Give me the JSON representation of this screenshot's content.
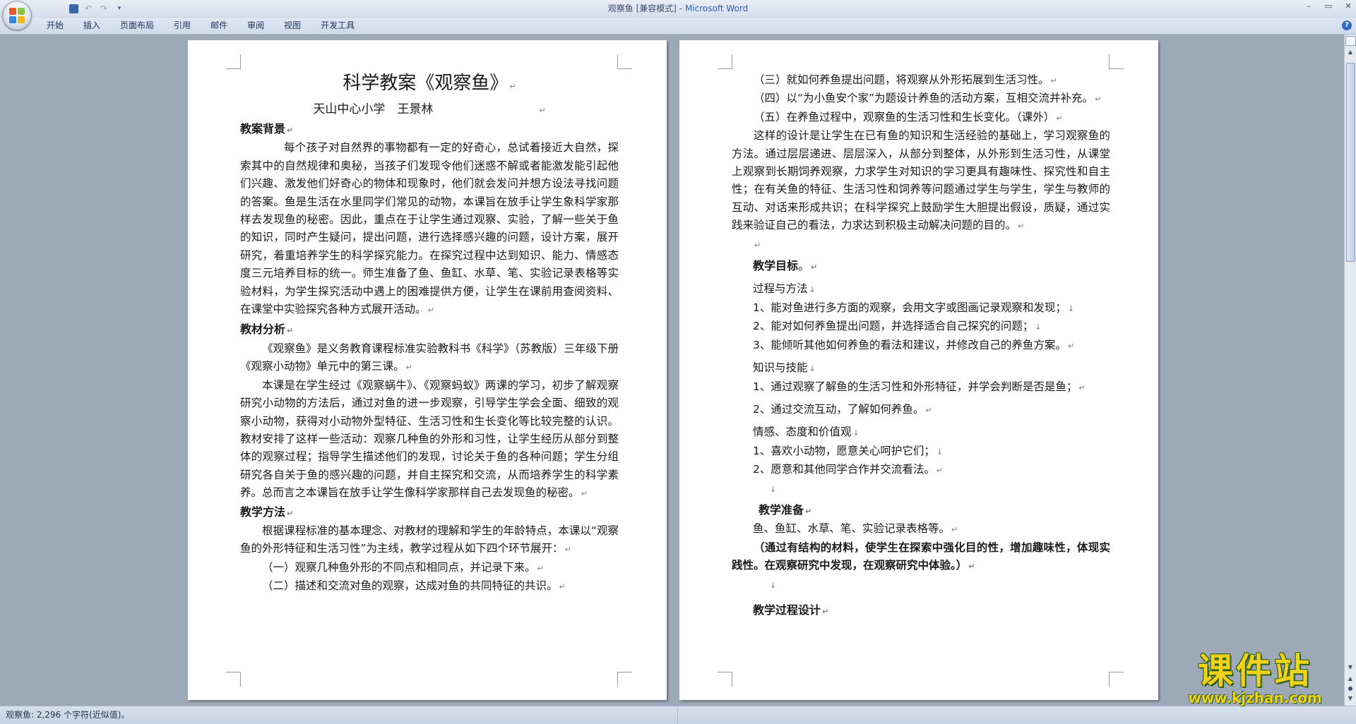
{
  "window": {
    "doc_name": "观察鱼",
    "mode": "[兼容模式]",
    "separator": "-",
    "app_name": "Microsoft Word"
  },
  "quick_access": [
    "save-icon",
    "undo-icon",
    "redo-icon",
    "customize-icon"
  ],
  "ribbon": {
    "tabs": [
      "开始",
      "插入",
      "页面布局",
      "引用",
      "邮件",
      "审阅",
      "视图",
      "开发工具"
    ]
  },
  "page_left": {
    "title": "科学教案《观察鱼》",
    "subtitle": "天山中心小学　王景林",
    "h_background": "教案背景",
    "background": "每个孩子对自然界的事物都有一定的好奇心，总试着接近大自然，探索其中的自然规律和奥秘，当孩子们发现令他们迷惑不解或者能激发能引起他们兴趣、激发他们好奇心的物体和现象时，他们就会发问并想方设法寻找问题的答案。鱼是生活在水里同学们常见的动物，本课旨在放手让学生象科学家那样去发现鱼的秘密。因此，重点在于让学生通过观察、实验，了解一些关于鱼的知识，同时产生疑问，提出问题，进行选择感兴趣的问题，设计方案，展开研究，着重培养学生的科学探究能力。在探究过程中达到知识、能力、情感态度三元培养目标的统一。师生准备了鱼、鱼缸、水草、笔、实验记录表格等实验材料，为学生探究活动中遇上的困难提供方便，让学生在课前用查阅资料、在课堂中实验探究各种方式展开活动。",
    "h_material": "教材分析",
    "material_1": "《观察鱼》是义务教育课程标准实验教科书《科学》（苏教版）三年级下册《观察小动物》单元中的第三课。",
    "material_2": "本课是在学生经过《观察蜗牛》、《观察蚂蚁》两课的学习，初步了解观察研究小动物的方法后，通过对鱼的进一步观察，引导学生学会全面、细致的观察小动物，获得对小动物外型特征、生活习性和生长变化等比较完整的认识。教材安排了这样一些活动：观察几种鱼的外形和习性，让学生经历从部分到整体的观察过程；指导学生描述他们的发现，讨论关于鱼的各种问题；学生分组研究各自关于鱼的感兴趣的问题，并自主探究和交流，从而培养学生的科学素养。总而言之本课旨在放手让学生像科学家那样自己去发现鱼的秘密。",
    "h_method": "教学方法",
    "method_intro": "根据课程标准的基本理念、对教材的理解和学生的年龄特点，本课以“观察鱼的外形特征和生活习性”为主线，教学过程从如下四个环节展开：",
    "method_1": "（一）观察几种鱼外形的不同点和相同点，并记录下来。",
    "method_2": "（二）描述和交流对鱼的观察，达成对鱼的共同特征的共识。"
  },
  "page_right": {
    "method_3": "（三）就如何养鱼提出问题，将观察从外形拓展到生活习性。",
    "method_4": "（四）以“为小鱼安个家”为题设计养鱼的活动方案，互相交流并补充。",
    "method_5": "（五）在养鱼过程中，观察鱼的生活习性和生长变化。（课外）",
    "design_note": "这样的设计是让学生在已有鱼的知识和生活经验的基础上，学习观察鱼的方法。通过层层递进、层层深入，从部分到整体，从外形到生活习性，从课堂上观察到长期饲养观察，力求学生对知识的学习更具有趣味性、探究性和自主性；在有关鱼的特征、生活习性和饲养等问题通过学生与学生，学生与教师的互动、对话来形成共识；在科学探究上鼓励学生大胆提出假设，质疑，通过实践来验证自己的看法，力求达到积极主动解决问题的目的。",
    "h_goals": "教学目标",
    "goal_period": "。",
    "g1_title": "过程与方法",
    "g1_items": [
      "1、能对鱼进行多方面的观察，会用文字或图画记录观察和发现；",
      "2、能对如何养鱼提出问题，并选择适合自己探究的问题；",
      "3、能倾听其他如何养鱼的看法和建议，并修改自己的养鱼方案。"
    ],
    "g2_title": "知识与技能",
    "g2_items": [
      "1、通过观察了解鱼的生活习性和外形特征，并学会判断是否是鱼；",
      "2、通过交流互动，了解如何养鱼。"
    ],
    "g3_title": "情感、态度和价值观",
    "g3_items": [
      "1、喜欢小动物，愿意关心呵护它们；",
      "2、愿意和其他同学合作并交流看法。"
    ],
    "h_prep": "教学准备",
    "prep": "鱼、鱼缸、水草、笔、实验记录表格等。",
    "prep_note": "（通过有结构的材料，使学生在探索中强化目的性，增加趣味性，体现实践性。在观察研究中发现，在观察研究中体验。）",
    "h_process": "教学过程设计"
  },
  "marks": {
    "para": "↵",
    "line": "↓"
  },
  "status": {
    "text": "观察鱼: 2,296 个字符(近似值)。"
  },
  "watermark": {
    "main": "课件站",
    "url": "www.kjzhan.com"
  }
}
